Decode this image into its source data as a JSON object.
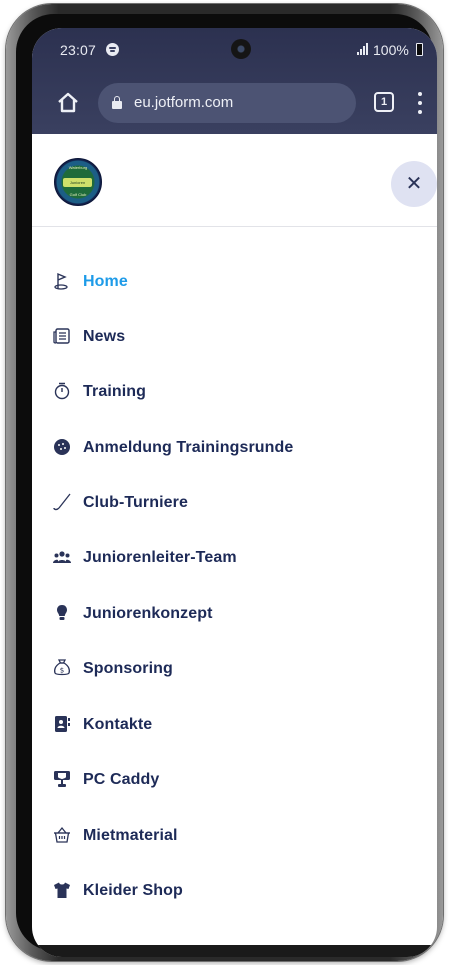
{
  "status_bar": {
    "time": "23:07",
    "battery": "100%"
  },
  "browser": {
    "url": "eu.jotform.com",
    "tab_count": "1"
  },
  "header": {
    "logo_top_text": "Waterburg",
    "logo_band_text": "Junioren",
    "logo_bottom_text": "Golf Club",
    "close_label": "✕"
  },
  "nav": {
    "items": [
      {
        "label": "Home",
        "icon": "golf-flag-icon",
        "active": true
      },
      {
        "label": "News",
        "icon": "newspaper-icon"
      },
      {
        "label": "Training",
        "icon": "stopwatch-icon"
      },
      {
        "label": "Anmeldung Trainingsrunde",
        "icon": "golf-ball-icon"
      },
      {
        "label": "Club-Turniere",
        "icon": "golf-club-icon"
      },
      {
        "label": "Juniorenleiter-Team",
        "icon": "team-icon"
      },
      {
        "label": "Juniorenkonzept",
        "icon": "lightbulb-icon"
      },
      {
        "label": "Sponsoring",
        "icon": "money-bag-icon"
      },
      {
        "label": "Kontakte",
        "icon": "address-book-icon"
      },
      {
        "label": "PC Caddy",
        "icon": "trophy-icon"
      },
      {
        "label": "Mietmaterial",
        "icon": "basket-icon"
      },
      {
        "label": "Kleider Shop",
        "icon": "tshirt-icon"
      }
    ]
  },
  "colors": {
    "active": "#1e9be8",
    "text": "#1d2a57",
    "browser_bar": "#2c3150"
  }
}
